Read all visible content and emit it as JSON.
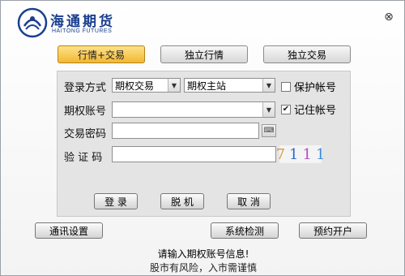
{
  "logo": {
    "cn": "海通期货",
    "en": "HAITONG FUTURES"
  },
  "window": {
    "close_glyph": "⊗"
  },
  "modes": [
    {
      "label": "行情+交易",
      "active": true
    },
    {
      "label": "独立行情",
      "active": false
    },
    {
      "label": "独立交易",
      "active": false
    }
  ],
  "form": {
    "login_mode_label": "登录方式",
    "login_type_value": "期权交易",
    "server_value": "期权主站",
    "protect_account_label": "保护帐号",
    "protect_account_checked": false,
    "account_label": "期权账号",
    "account_value": "",
    "remember_account_label": "记住帐号",
    "remember_account_checked": true,
    "password_label": "交易密码",
    "password_value": "",
    "captcha_label": "验 证 码",
    "captcha_input_value": "",
    "captcha_code": [
      "7",
      "1",
      "1",
      "1"
    ],
    "captcha_colors": [
      "#d89a3a",
      "#2a6acb",
      "#b14fc5",
      "#3c8bd6"
    ]
  },
  "actions": {
    "login": "登 录",
    "offline": "脱 机",
    "cancel": "取 消"
  },
  "bottom": {
    "comm_settings": "通讯设置",
    "system_check": "系统检测",
    "reserve_account": "预约开户"
  },
  "status": {
    "message": "请输入期权账号信息!",
    "risk_notice": "股市有风险，入市需谨慎"
  }
}
